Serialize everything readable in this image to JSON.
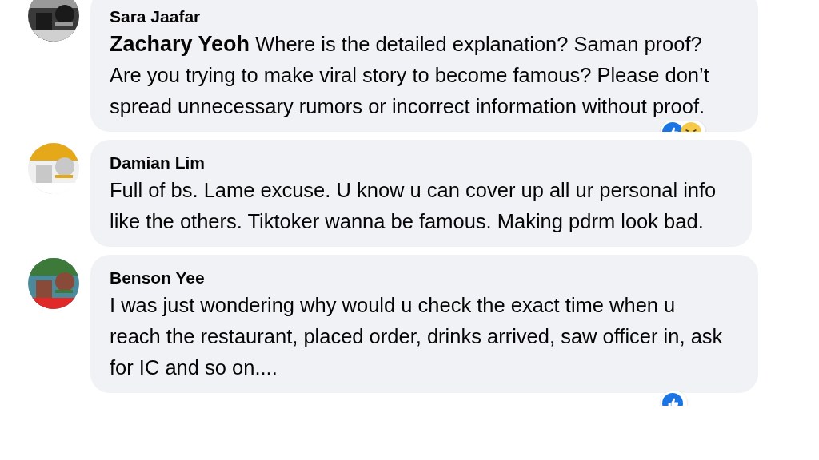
{
  "comments": [
    {
      "author": "Sara Jaafar",
      "text": "**Zachary Yeoh** Where is the detailed explanation? Saman proof? Are you trying to make viral story to become famous? Please don’t spread unnecessary rumors or incorrect information without proof.",
      "reactions": [
        {
          "kind": "like"
        },
        {
          "kind": "haha"
        }
      ],
      "avatar": {
        "kind": "picture"
      }
    },
    {
      "author": "Damian Lim",
      "text": "Full of bs. Lame excuse. U know u can cover up all ur personal info like the others. Tiktoker wanna be famous. Making pdrm look bad.",
      "avatar": {
        "kind": "picture"
      }
    },
    {
      "author": "Benson Yee",
      "text": "I was just wondering why would u check the exact time when u reach the restaurant, placed order, drinks arrived, saw officer in, ask for IC and so on....",
      "reactions": [
        {
          "kind": "like"
        }
      ],
      "avatar": {
        "kind": "picture"
      }
    }
  ]
}
